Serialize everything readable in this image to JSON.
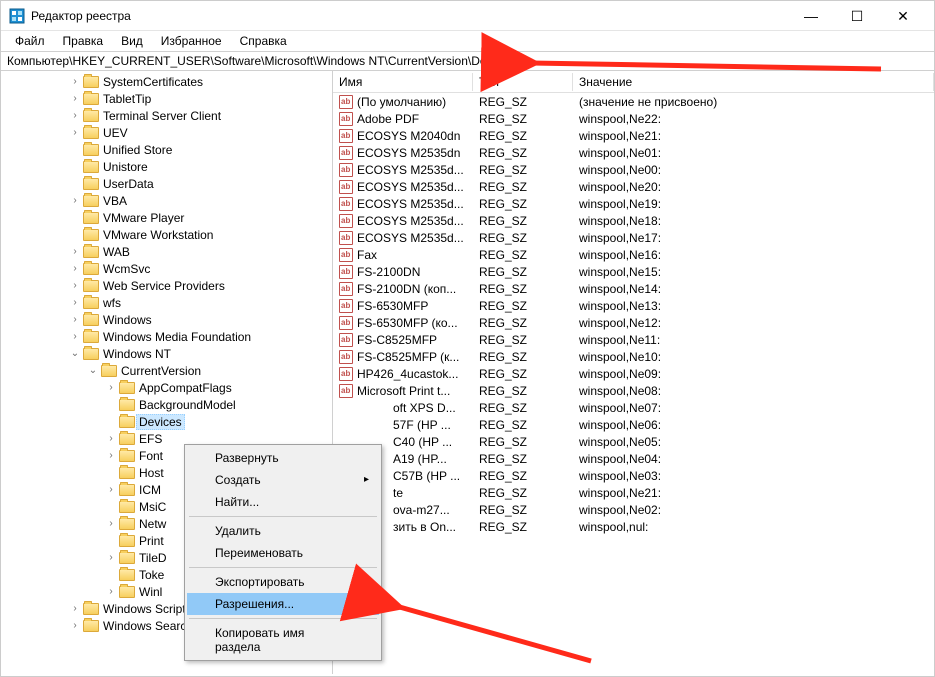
{
  "window": {
    "title": "Редактор реестра",
    "controls": {
      "min": "—",
      "max": "☐",
      "close": "✕"
    }
  },
  "menu": [
    "Файл",
    "Правка",
    "Вид",
    "Избранное",
    "Справка"
  ],
  "address": "Компьютер\\HKEY_CURRENT_USER\\Software\\Microsoft\\Windows NT\\CurrentVersion\\Devices",
  "tree": [
    {
      "indent": 3,
      "toggle": ">",
      "label": "SystemCertificates"
    },
    {
      "indent": 3,
      "toggle": ">",
      "label": "TabletTip"
    },
    {
      "indent": 3,
      "toggle": ">",
      "label": "Terminal Server Client"
    },
    {
      "indent": 3,
      "toggle": ">",
      "label": "UEV"
    },
    {
      "indent": 3,
      "toggle": "",
      "label": "Unified Store"
    },
    {
      "indent": 3,
      "toggle": "",
      "label": "Unistore"
    },
    {
      "indent": 3,
      "toggle": "",
      "label": "UserData"
    },
    {
      "indent": 3,
      "toggle": ">",
      "label": "VBA"
    },
    {
      "indent": 3,
      "toggle": "",
      "label": "VMware Player"
    },
    {
      "indent": 3,
      "toggle": "",
      "label": "VMware Workstation"
    },
    {
      "indent": 3,
      "toggle": ">",
      "label": "WAB"
    },
    {
      "indent": 3,
      "toggle": ">",
      "label": "WcmSvc"
    },
    {
      "indent": 3,
      "toggle": ">",
      "label": "Web Service Providers"
    },
    {
      "indent": 3,
      "toggle": ">",
      "label": "wfs"
    },
    {
      "indent": 3,
      "toggle": ">",
      "label": "Windows"
    },
    {
      "indent": 3,
      "toggle": ">",
      "label": "Windows Media Foundation"
    },
    {
      "indent": 3,
      "toggle": "v",
      "label": "Windows NT"
    },
    {
      "indent": 4,
      "toggle": "v",
      "label": "CurrentVersion"
    },
    {
      "indent": 5,
      "toggle": ">",
      "label": "AppCompatFlags"
    },
    {
      "indent": 5,
      "toggle": "",
      "label": "BackgroundModel"
    },
    {
      "indent": 5,
      "toggle": "",
      "label": "Devices",
      "selected": true
    },
    {
      "indent": 5,
      "toggle": ">",
      "label": "EFS"
    },
    {
      "indent": 5,
      "toggle": ">",
      "label": "Font"
    },
    {
      "indent": 5,
      "toggle": "",
      "label": "Host"
    },
    {
      "indent": 5,
      "toggle": ">",
      "label": "ICM"
    },
    {
      "indent": 5,
      "toggle": "",
      "label": "MsiC"
    },
    {
      "indent": 5,
      "toggle": ">",
      "label": "Netw"
    },
    {
      "indent": 5,
      "toggle": "",
      "label": "Print"
    },
    {
      "indent": 5,
      "toggle": ">",
      "label": "TileD"
    },
    {
      "indent": 5,
      "toggle": "",
      "label": "Toke"
    },
    {
      "indent": 5,
      "toggle": ">",
      "label": "Winl"
    },
    {
      "indent": 3,
      "toggle": ">",
      "label": "Windows Script Host"
    },
    {
      "indent": 3,
      "toggle": ">",
      "label": "Windows Search"
    }
  ],
  "listHeader": {
    "name": "Имя",
    "type": "Тип",
    "value": "Значение"
  },
  "rows": [
    {
      "name": "(По умолчанию)",
      "type": "REG_SZ",
      "value": "(значение не присвоено)"
    },
    {
      "name": "Adobe PDF",
      "type": "REG_SZ",
      "value": "winspool,Ne22:"
    },
    {
      "name": "ECOSYS M2040dn",
      "type": "REG_SZ",
      "value": "winspool,Ne21:"
    },
    {
      "name": "ECOSYS M2535dn",
      "type": "REG_SZ",
      "value": "winspool,Ne01:"
    },
    {
      "name": "ECOSYS M2535d...",
      "type": "REG_SZ",
      "value": "winspool,Ne00:"
    },
    {
      "name": "ECOSYS M2535d...",
      "type": "REG_SZ",
      "value": "winspool,Ne20:"
    },
    {
      "name": "ECOSYS M2535d...",
      "type": "REG_SZ",
      "value": "winspool,Ne19:"
    },
    {
      "name": "ECOSYS M2535d...",
      "type": "REG_SZ",
      "value": "winspool,Ne18:"
    },
    {
      "name": "ECOSYS M2535d...",
      "type": "REG_SZ",
      "value": "winspool,Ne17:"
    },
    {
      "name": "Fax",
      "type": "REG_SZ",
      "value": "winspool,Ne16:"
    },
    {
      "name": "FS-2100DN",
      "type": "REG_SZ",
      "value": "winspool,Ne15:"
    },
    {
      "name": "FS-2100DN (коп...",
      "type": "REG_SZ",
      "value": "winspool,Ne14:"
    },
    {
      "name": "FS-6530MFP",
      "type": "REG_SZ",
      "value": "winspool,Ne13:"
    },
    {
      "name": "FS-6530MFP (ко...",
      "type": "REG_SZ",
      "value": "winspool,Ne12:"
    },
    {
      "name": "FS-C8525MFP",
      "type": "REG_SZ",
      "value": "winspool,Ne11:"
    },
    {
      "name": "FS-C8525MFP (к...",
      "type": "REG_SZ",
      "value": "winspool,Ne10:"
    },
    {
      "name": "HP426_4ucastok...",
      "type": "REG_SZ",
      "value": "winspool,Ne09:"
    },
    {
      "name": "Microsoft Print t...",
      "type": "REG_SZ",
      "value": "winspool,Ne08:"
    },
    {
      "name": "oft XPS D...",
      "type": "REG_SZ",
      "value": "winspool,Ne07:",
      "clip": true
    },
    {
      "name": "57F (HP ...",
      "type": "REG_SZ",
      "value": "winspool,Ne06:",
      "clip": true
    },
    {
      "name": "C40 (HP ...",
      "type": "REG_SZ",
      "value": "winspool,Ne05:",
      "clip": true
    },
    {
      "name": "A19 (HP...",
      "type": "REG_SZ",
      "value": "winspool,Ne04:",
      "clip": true
    },
    {
      "name": "C57B (HP ...",
      "type": "REG_SZ",
      "value": "winspool,Ne03:",
      "clip": true
    },
    {
      "name": "te",
      "type": "REG_SZ",
      "value": "winspool,Ne21:",
      "clip": true
    },
    {
      "name": "ova-m27...",
      "type": "REG_SZ",
      "value": "winspool,Ne02:",
      "clip": true
    },
    {
      "name": "зить в On...",
      "type": "REG_SZ",
      "value": "winspool,nul:",
      "clip": true
    }
  ],
  "contextMenu": {
    "items": [
      {
        "label": "Развернуть"
      },
      {
        "label": "Создать",
        "submenu": true
      },
      {
        "label": "Найти..."
      },
      {
        "sep": true
      },
      {
        "label": "Удалить"
      },
      {
        "label": "Переименовать"
      },
      {
        "sep": true
      },
      {
        "label": "Экспортировать"
      },
      {
        "label": "Разрешения...",
        "highlight": true
      },
      {
        "sep": true
      },
      {
        "label": "Копировать имя раздела"
      }
    ]
  }
}
